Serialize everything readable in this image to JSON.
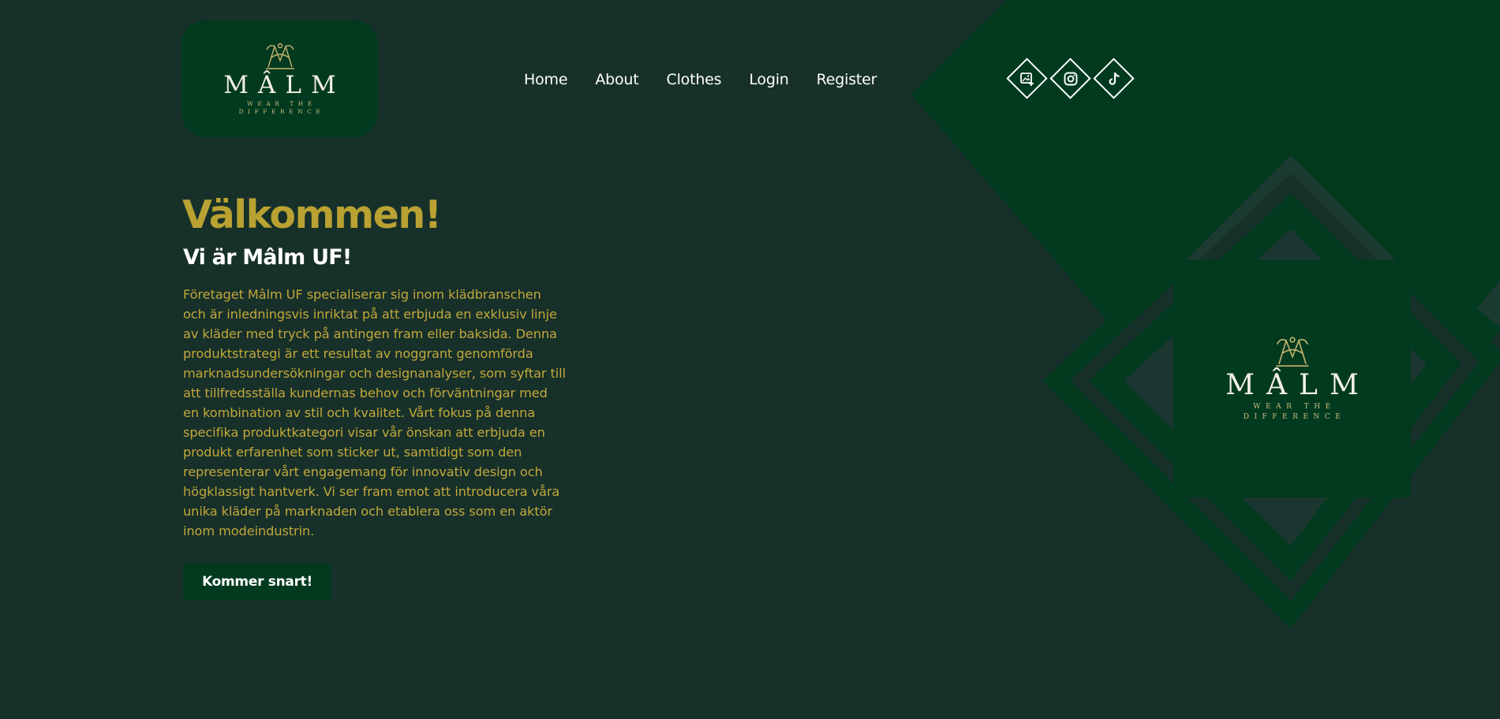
{
  "brand": {
    "name": "MÂLM",
    "tagline": "WEAR THE DIFFERENCE"
  },
  "nav": {
    "items": [
      {
        "label": "Home"
      },
      {
        "label": "About"
      },
      {
        "label": "Clothes"
      },
      {
        "label": "Login"
      },
      {
        "label": "Register"
      }
    ]
  },
  "socials": [
    {
      "icon": "add-photo-icon"
    },
    {
      "icon": "instagram-icon"
    },
    {
      "icon": "tiktok-icon"
    }
  ],
  "hero": {
    "title": "Välkommen!",
    "subtitle": "Vi är Mâlm UF!",
    "body": "Företaget Mâlm UF specialiserar sig inom klädbranschen och är inledningsvis inriktat på att erbjuda en exklusiv linje av kläder med tryck på antingen fram eller baksida. Denna produktstrategi är ett resultat av noggrant genomförda marknadsundersökningar och designanalyser, som syftar till att tillfredsställa kundernas behov och förväntningar med en kombination av stil och kvalitet. Vårt fokus på denna specifika produktkategori visar vår önskan att erbjuda en produkt erfarenhet som sticker ut, samtidigt som den representerar vårt engagemang för innovativ design och högklassigt hantverk. Vi ser fram emot att introducera våra unika kläder på marknaden och etablera oss som en aktör inom modeindustrin.",
    "cta_label": "Kommer snart!"
  },
  "colors": {
    "background": "#17302a",
    "deep_green": "#013a1e",
    "gold": "#b9a232",
    "text_gold": "#c2a83a",
    "white": "#ffffff"
  }
}
